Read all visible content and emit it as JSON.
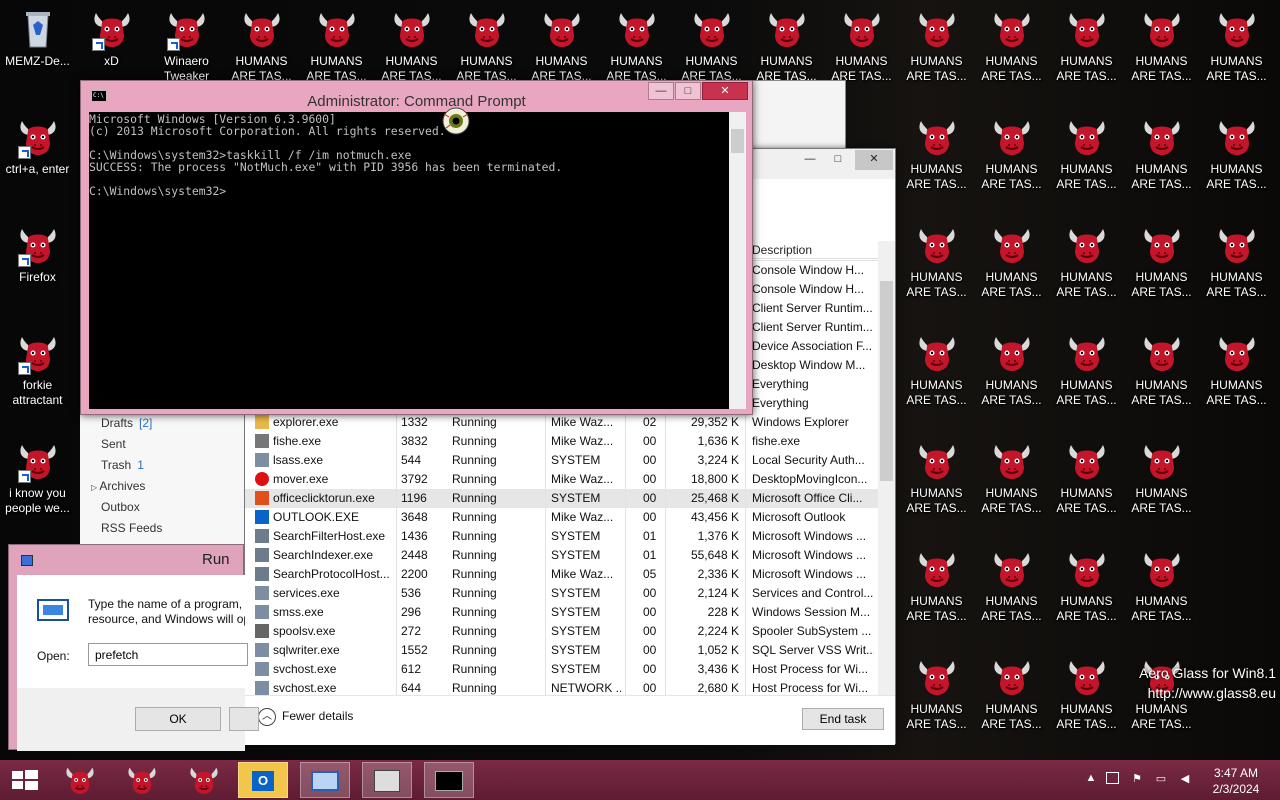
{
  "desktop_icons": [
    {
      "label": "MEMZ-De...",
      "type": "recycle"
    },
    {
      "label": "xD",
      "type": "bull"
    },
    {
      "label": "Winaero Tweaker",
      "type": "bull"
    },
    {
      "label": "HUMANS ARE TAS...",
      "type": "bull"
    },
    {
      "label": "ctrl+a, enter",
      "type": "bull"
    },
    {
      "label": "Firefox",
      "type": "bull"
    },
    {
      "label": "forkie attractant",
      "type": "bull"
    },
    {
      "label": "i know you people we...",
      "type": "bull"
    }
  ],
  "humans_label": "HUMANS ARE TAS...",
  "cmd": {
    "title": "Administrator: Command Prompt",
    "lines": [
      "Microsoft Windows [Version 6.3.9600]",
      "(c) 2013 Microsoft Corporation. All rights reserved.",
      "",
      "C:\\Windows\\system32>taskkill /f /im notmuch.exe",
      "SUCCESS: The process \"NotMuch.exe\" with PID 3956 has been terminated.",
      "",
      "C:\\Windows\\system32>"
    ],
    "icon_text": "C:\\",
    "minimize": "—",
    "maximize": "□",
    "close": "✕"
  },
  "taskmgr": {
    "column_header": "Description",
    "minimize": "—",
    "maximize": "□",
    "close": "✕",
    "rows": [
      {
        "name": "",
        "pid": "",
        "status": "",
        "user": "",
        "cpu": "",
        "mem": "",
        "desc": "Console Window H...",
        "icon": "none"
      },
      {
        "name": "",
        "pid": "",
        "status": "",
        "user": "",
        "cpu": "",
        "mem": "",
        "desc": "Console Window H...",
        "icon": "none"
      },
      {
        "name": "",
        "pid": "",
        "status": "",
        "user": "",
        "cpu": "",
        "mem": "",
        "desc": "Client Server Runtim...",
        "icon": "none"
      },
      {
        "name": "",
        "pid": "",
        "status": "",
        "user": "",
        "cpu": "",
        "mem": "",
        "desc": "Client Server Runtim...",
        "icon": "none"
      },
      {
        "name": "",
        "pid": "",
        "status": "",
        "user": "",
        "cpu": "",
        "mem": "",
        "desc": "Device Association F...",
        "icon": "none"
      },
      {
        "name": "",
        "pid": "",
        "status": "",
        "user": "",
        "cpu": "",
        "mem": "",
        "desc": "Desktop Window M...",
        "icon": "none"
      },
      {
        "name": "",
        "pid": "",
        "status": "",
        "user": "",
        "cpu": "",
        "mem": "",
        "desc": "Everything",
        "icon": "none"
      },
      {
        "name": "",
        "pid": "",
        "status": "",
        "user": "",
        "cpu": "",
        "mem": "",
        "desc": "Everything",
        "icon": "none"
      },
      {
        "name": "explorer.exe",
        "pid": "1332",
        "status": "Running",
        "user": "Mike Waz...",
        "cpu": "02",
        "mem": "29,352 K",
        "desc": "Windows Explorer",
        "icon": "folder"
      },
      {
        "name": "fishe.exe",
        "pid": "3832",
        "status": "Running",
        "user": "Mike Waz...",
        "cpu": "00",
        "mem": "1,636 K",
        "desc": "fishe.exe",
        "icon": "fish"
      },
      {
        "name": "lsass.exe",
        "pid": "544",
        "status": "Running",
        "user": "SYSTEM",
        "cpu": "00",
        "mem": "3,224 K",
        "desc": "Local Security Auth...",
        "icon": "generic"
      },
      {
        "name": "mover.exe",
        "pid": "3792",
        "status": "Running",
        "user": "Mike Waz...",
        "cpu": "00",
        "mem": "18,800 K",
        "desc": "DesktopMovingIcon...",
        "icon": "error"
      },
      {
        "name": "officeclicktorun.exe",
        "pid": "1196",
        "status": "Running",
        "user": "SYSTEM",
        "cpu": "00",
        "mem": "25,468 K",
        "desc": "Microsoft Office Cli...",
        "icon": "office"
      },
      {
        "name": "OUTLOOK.EXE",
        "pid": "3648",
        "status": "Running",
        "user": "Mike Waz...",
        "cpu": "00",
        "mem": "43,456 K",
        "desc": "Microsoft Outlook",
        "icon": "outlook"
      },
      {
        "name": "SearchFilterHost.exe",
        "pid": "1436",
        "status": "Running",
        "user": "SYSTEM",
        "cpu": "01",
        "mem": "1,376 K",
        "desc": "Microsoft Windows ...",
        "icon": "search"
      },
      {
        "name": "SearchIndexer.exe",
        "pid": "2448",
        "status": "Running",
        "user": "SYSTEM",
        "cpu": "01",
        "mem": "55,648 K",
        "desc": "Microsoft Windows ...",
        "icon": "search"
      },
      {
        "name": "SearchProtocolHost...",
        "pid": "2200",
        "status": "Running",
        "user": "Mike Waz...",
        "cpu": "05",
        "mem": "2,336 K",
        "desc": "Microsoft Windows ...",
        "icon": "search"
      },
      {
        "name": "services.exe",
        "pid": "536",
        "status": "Running",
        "user": "SYSTEM",
        "cpu": "00",
        "mem": "2,124 K",
        "desc": "Services and Control...",
        "icon": "generic"
      },
      {
        "name": "smss.exe",
        "pid": "296",
        "status": "Running",
        "user": "SYSTEM",
        "cpu": "00",
        "mem": "228 K",
        "desc": "Windows Session M...",
        "icon": "generic"
      },
      {
        "name": "spoolsv.exe",
        "pid": "272",
        "status": "Running",
        "user": "SYSTEM",
        "cpu": "00",
        "mem": "2,224 K",
        "desc": "Spooler SubSystem ...",
        "icon": "printer"
      },
      {
        "name": "sqlwriter.exe",
        "pid": "1552",
        "status": "Running",
        "user": "SYSTEM",
        "cpu": "00",
        "mem": "1,052 K",
        "desc": "SQL Server VSS Writ...",
        "icon": "generic"
      },
      {
        "name": "svchost.exe",
        "pid": "612",
        "status": "Running",
        "user": "SYSTEM",
        "cpu": "00",
        "mem": "3,436 K",
        "desc": "Host Process for Wi...",
        "icon": "generic"
      },
      {
        "name": "svchost.exe",
        "pid": "644",
        "status": "Running",
        "user": "NETWORK ...",
        "cpu": "00",
        "mem": "2,680 K",
        "desc": "Host Process for Wi...",
        "icon": "generic"
      }
    ],
    "selected_row": 12,
    "fewer_details": "Fewer details",
    "end_task": "End task"
  },
  "outlook_nav": [
    {
      "label": "Drafts",
      "count": "[2]"
    },
    {
      "label": "Sent",
      "count": ""
    },
    {
      "label": "Trash",
      "count": "1"
    },
    {
      "label": "Archives",
      "count": ""
    },
    {
      "label": "Outbox",
      "count": ""
    },
    {
      "label": "RSS Feeds",
      "count": ""
    }
  ],
  "run": {
    "title": "Run",
    "description_line1": "Type the name of a program, f",
    "description_line2": "resource, and Windows will op",
    "open_label": "Open:",
    "open_value": "prefetch",
    "ok_label": "OK"
  },
  "aero": {
    "line1": "Aero Glass for Win8.1",
    "line2": "http://www.glass8.eu"
  },
  "clock": {
    "time": "3:47 AM",
    "date": "2/3/2024"
  },
  "taskbar_items": [
    "start",
    "bull-app-1",
    "bull-app-2",
    "bull-app-3",
    "outlook",
    "run-dialog",
    "task-manager",
    "command-prompt"
  ],
  "colors": {
    "accent": "#e6a2bd",
    "taskbar": "#6b2038",
    "bull": "#c4152a"
  }
}
